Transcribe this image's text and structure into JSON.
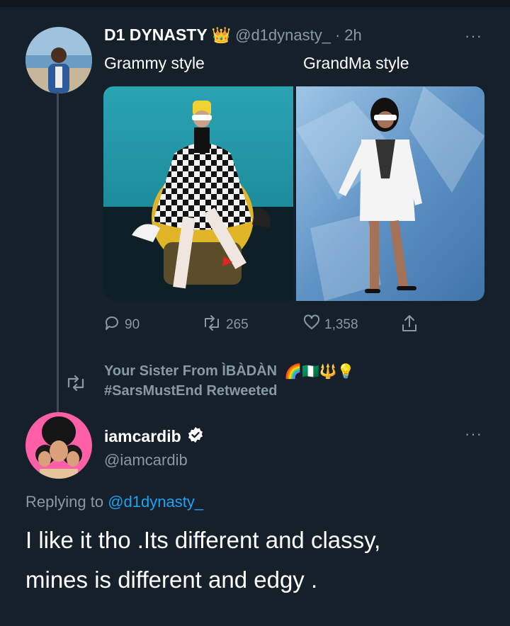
{
  "tweet1": {
    "author_name": "D1 DYNASTY",
    "author_emoji": "👑",
    "handle": "@d1dynasty_",
    "separator": "·",
    "time": "2h",
    "caption_left": "Grammy style",
    "caption_right": "GrandMa style",
    "replies": "90",
    "retweets": "265",
    "likes": "1,358"
  },
  "retweet_banner": {
    "line1": "Your Sister From ÌBÀDÀN",
    "emoji": "🌈🇳🇬🔱💡",
    "line2": "#SarsMustEnd Retweeted"
  },
  "tweet2": {
    "author_name": "iamcardib",
    "handle": "@iamcardib",
    "replying_prefix": "Replying to",
    "replying_handle": "@d1dynasty_",
    "text_line1": "I like it tho .Its different and classy,",
    "text_line2": "mines is different and edgy ."
  },
  "more_label": "···",
  "colors": {
    "background": "#15202b",
    "muted": "#8899a6",
    "link": "#1da1f2",
    "verified": "#ffffff"
  }
}
